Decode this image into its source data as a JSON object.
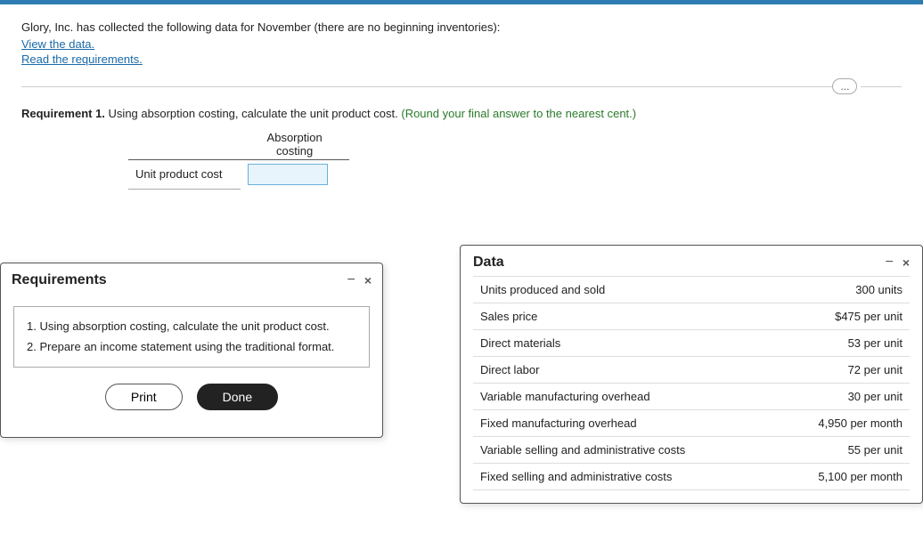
{
  "topbar": {
    "color": "#2d7db3"
  },
  "main": {
    "intro": "Glory, Inc. has collected the following data for November (there are no beginning inventories):",
    "view_link": "View the data.",
    "read_link": "Read the requirements.",
    "ellipsis": "...",
    "requirement_label": "Requirement 1.",
    "requirement_text": "Using absorption costing, calculate the unit product cost.",
    "requirement_note": "(Round your final answer to the nearest cent.)",
    "table": {
      "header": "Absorption\ncosting",
      "header_line1": "Absorption",
      "header_line2": "costing",
      "row_label": "Unit product cost",
      "input_value": ""
    }
  },
  "requirements_modal": {
    "title": "Requirements",
    "minimize": "−",
    "close": "×",
    "items": [
      "1.  Using absorption costing, calculate the unit product cost.",
      "2.  Prepare an income statement using the traditional format."
    ],
    "print_btn": "Print",
    "done_btn": "Done"
  },
  "data_modal": {
    "title": "Data",
    "minimize": "−",
    "close": "×",
    "rows": [
      {
        "label": "Units produced and sold",
        "value": "300 units"
      },
      {
        "label": "Sales price",
        "value": "$475 per unit"
      },
      {
        "label": "Direct materials",
        "value": "53 per unit"
      },
      {
        "label": "Direct labor",
        "value": "72 per unit"
      },
      {
        "label": "Variable manufacturing overhead",
        "value": "30 per unit"
      },
      {
        "label": "Fixed manufacturing overhead",
        "value": "4,950 per month"
      },
      {
        "label": "Variable selling and administrative costs",
        "value": "55 per unit"
      },
      {
        "label": "Fixed selling and administrative costs",
        "value": "5,100 per month"
      }
    ]
  }
}
